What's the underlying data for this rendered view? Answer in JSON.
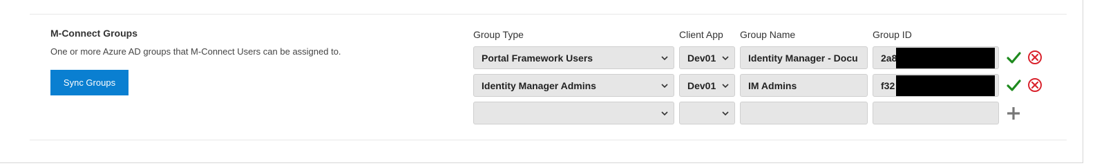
{
  "section": {
    "title": "M-Connect Groups",
    "description": "One or more Azure AD groups that M-Connect Users can be assigned to.",
    "sync_button": "Sync Groups"
  },
  "columns": {
    "group_type": "Group Type",
    "client_app": "Client App",
    "group_name": "Group Name",
    "group_id": "Group ID"
  },
  "rows": [
    {
      "group_type": "Portal Framework Users",
      "client_app": "Dev01",
      "group_name": "Identity Manager - Docu",
      "group_id": "2a8"
    },
    {
      "group_type": "Identity Manager Admins",
      "client_app": "Dev01",
      "group_name": "IM Admins",
      "group_id": "f32"
    },
    {
      "group_type": "",
      "client_app": "",
      "group_name": "",
      "group_id": ""
    }
  ],
  "colors": {
    "accent": "#0a7fd1",
    "confirm": "#1e8a1e",
    "cancel": "#d9232d",
    "add": "#777777"
  },
  "icons": {
    "confirm": "check-icon",
    "remove": "cancel-icon",
    "add": "plus-icon",
    "dropdown": "chevron-down-icon"
  }
}
